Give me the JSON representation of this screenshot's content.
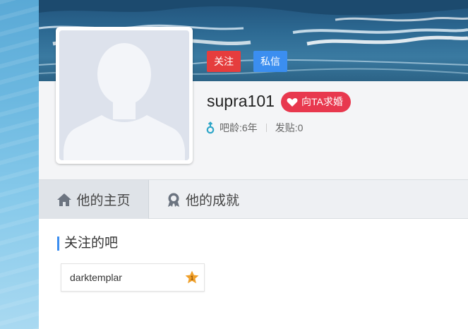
{
  "profile": {
    "username": "supra101",
    "follow_label": "关注",
    "message_label": "私信",
    "propose_label": "向TA求婚",
    "bar_age": "吧龄:6年",
    "posts": "发贴:0",
    "gender_icon": "male-icon",
    "propose_icon": "heart-icon"
  },
  "tabs": [
    {
      "label": "他的主页",
      "icon": "home-icon"
    },
    {
      "label": "他的成就",
      "icon": "medal-icon"
    }
  ],
  "followed_section": {
    "title": "关注的吧",
    "forums": [
      {
        "name": "darktemplar",
        "icon": "star-badge-icon"
      }
    ]
  },
  "colors": {
    "follow_button": "#e53d3d",
    "message_button": "#3b8ef0",
    "propose_badge": "#e8384e",
    "accent_blue": "#3b8ef0"
  }
}
